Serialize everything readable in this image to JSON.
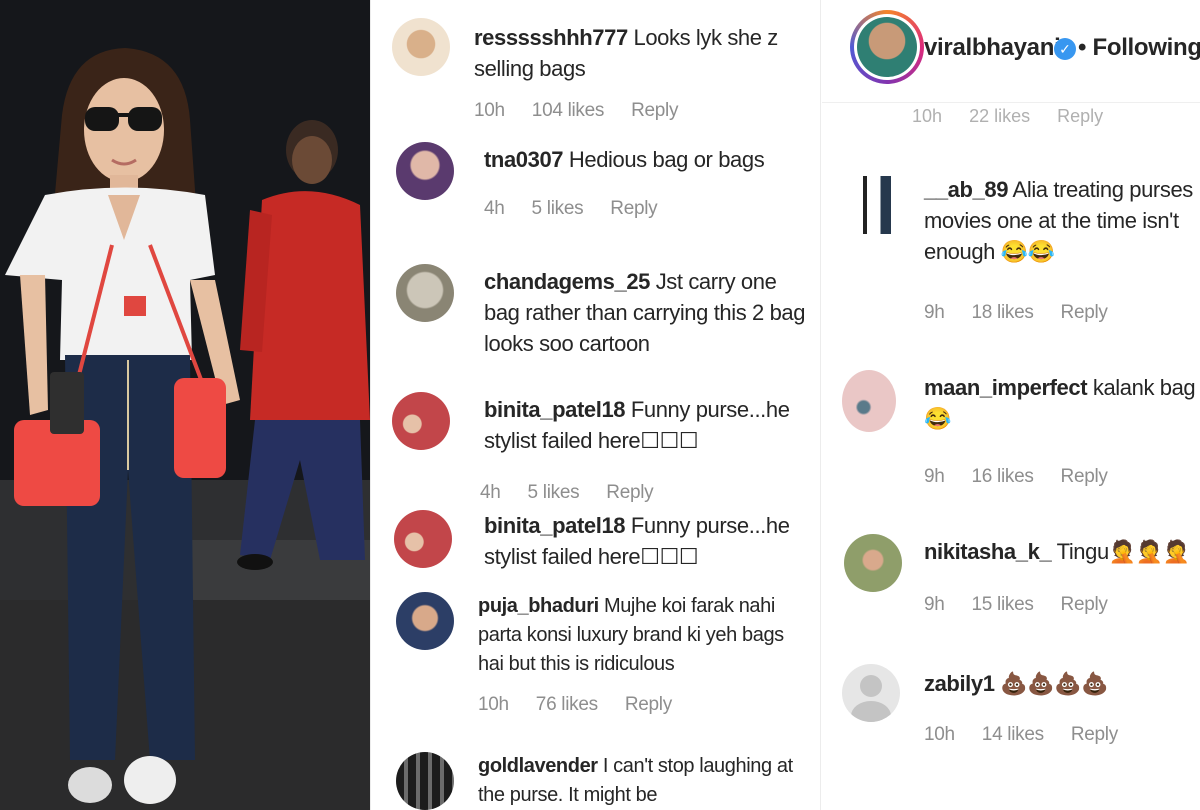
{
  "left_comments": [
    {
      "user": "ressssshhh777",
      "text": " Looks lyk she z selling bags",
      "time": "10h",
      "likes": "104 likes",
      "reply": "Reply"
    },
    {
      "user": "tna0307",
      "text": " Hedious bag or bags",
      "time": "4h",
      "likes": "5 likes",
      "reply": "Reply"
    },
    {
      "user": "chandagems_25",
      "text": " Jst carry one bag rather than carrying this 2 bag looks soo cartoon",
      "time": "",
      "likes": "",
      "reply": ""
    },
    {
      "user": "binita_patel18",
      "text": " Funny purse...he stylist failed here☐☐☐",
      "time": "4h",
      "likes": "5 likes",
      "reply": "Reply"
    },
    {
      "user": "binita_patel18",
      "text": " Funny purse...he stylist failed here☐☐☐",
      "time": "",
      "likes": "",
      "reply": ""
    },
    {
      "user": "puja_bhaduri",
      "text": " Mujhe koi farak nahi parta konsi luxury brand ki yeh bags hai but this is ridiculous",
      "time": "10h",
      "likes": "76 likes",
      "reply": "Reply"
    },
    {
      "user": "goldlavender",
      "text": " I can't stop laughing at the purse. It might be",
      "time": "",
      "likes": "",
      "reply": ""
    }
  ],
  "right_header": {
    "username": "viralbhayani",
    "verified_mark": "✓",
    "follow_label": "• Following",
    "cutoff_meta": [
      "10h",
      "22 likes",
      "Reply"
    ]
  },
  "right_comments": [
    {
      "user": "__ab_89",
      "text": " Alia treating purses movies one at the time isn't enough 😂😂",
      "time": "9h",
      "likes": "18 likes",
      "reply": "Reply"
    },
    {
      "user": "maan_imperfect",
      "text": " kalank bag 😂",
      "time": "9h",
      "likes": "16 likes",
      "reply": "Reply"
    },
    {
      "user": "nikitasha_k_",
      "text": " Tingu🤦🤦🤦",
      "time": "9h",
      "likes": "15 likes",
      "reply": "Reply"
    },
    {
      "user": "zabily1",
      "text": " 💩💩💩💩",
      "time": "10h",
      "likes": "14 likes",
      "reply": "Reply"
    }
  ],
  "colors": {
    "meta": "#8e8e8e",
    "text": "#262626",
    "verified": "#3897f0",
    "red_outfit": "#c62a25",
    "bag": "#ee4a44"
  },
  "icons": [
    "verified-badge-icon",
    "default-avatar-icon"
  ]
}
